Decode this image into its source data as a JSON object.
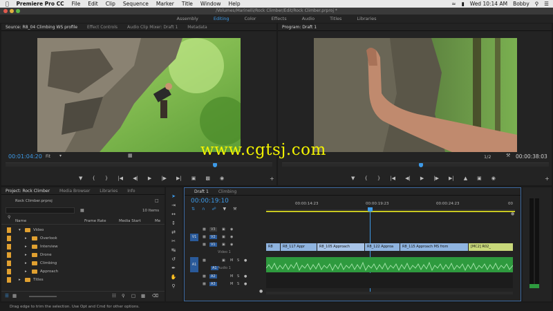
{
  "menubar": {
    "app_name": "Premiere Pro CC",
    "items": [
      "File",
      "Edit",
      "Clip",
      "Sequence",
      "Marker",
      "Title",
      "Window",
      "Help"
    ],
    "clock": "Wed 10:14 AM",
    "user": "Bobby"
  },
  "window": {
    "title": "/Volumes/Marinelli/Rock Climber/Edit/Rock Climber.prproj *"
  },
  "workspaces": {
    "items": [
      "Assembly",
      "Editing",
      "Color",
      "Effects",
      "Audio",
      "Titles",
      "Libraries"
    ],
    "active": "Editing"
  },
  "source_monitor": {
    "tabs": [
      "Source: R8_04 Climbing WS profile",
      "Effect Controls",
      "Audio Clip Mixer: Draft 1",
      "Metadata"
    ],
    "timecode": "00:01:04:20",
    "fit": "Fit"
  },
  "program_monitor": {
    "tabs": [
      "Program: Draft 1"
    ],
    "zoom": "1/2",
    "timecode": "00:00:38:03"
  },
  "project_panel": {
    "tabs": [
      "Project: Rock Climber",
      "Media Browser",
      "Libraries",
      "Info"
    ],
    "file": "Rock Climber.prproj",
    "count": "10 Items",
    "columns": [
      "Name",
      "Frame Rate",
      "Media Start",
      "Me"
    ],
    "items": [
      {
        "name": "Video",
        "level": 0
      },
      {
        "name": "Overlook",
        "level": 1
      },
      {
        "name": "Interview",
        "level": 1
      },
      {
        "name": "Drone",
        "level": 1
      },
      {
        "name": "Climbing",
        "level": 1
      },
      {
        "name": "Approach",
        "level": 1
      },
      {
        "name": "Titles",
        "level": 0
      }
    ]
  },
  "timeline": {
    "tabs": [
      "Draft 1",
      "Climbing"
    ],
    "timecode": "00:00:19:10",
    "ruler": [
      "00:00:14:23",
      "00:00:19:23",
      "00:00:24:23",
      "00"
    ],
    "video_tracks": [
      "V3",
      "V2",
      "V1"
    ],
    "audio_tracks": [
      "A1",
      "A2",
      "A3"
    ],
    "source_patch_v": "V1",
    "source_patch_a": "A1",
    "v1_label": "Video 1",
    "a1_label": "Audio 1",
    "clips": [
      {
        "label": "R8"
      },
      {
        "label": "R8_117 Appr"
      },
      {
        "label": "R8_105 Approach"
      },
      {
        "label": "R8_122 Approa"
      },
      {
        "label": "R8_115 Approach MS from"
      },
      {
        "label": "[MC2] R02_"
      }
    ]
  },
  "watermark": "www.cgtsj.com",
  "status_bar": "Drag edge to trim the selection. Use Opt and Cmd for other options.",
  "colors": {
    "accent": "#3d9ae8",
    "clip_blue": "#8fb4e0",
    "audio_green": "#2e9a3e",
    "folder": "#e0a030"
  }
}
